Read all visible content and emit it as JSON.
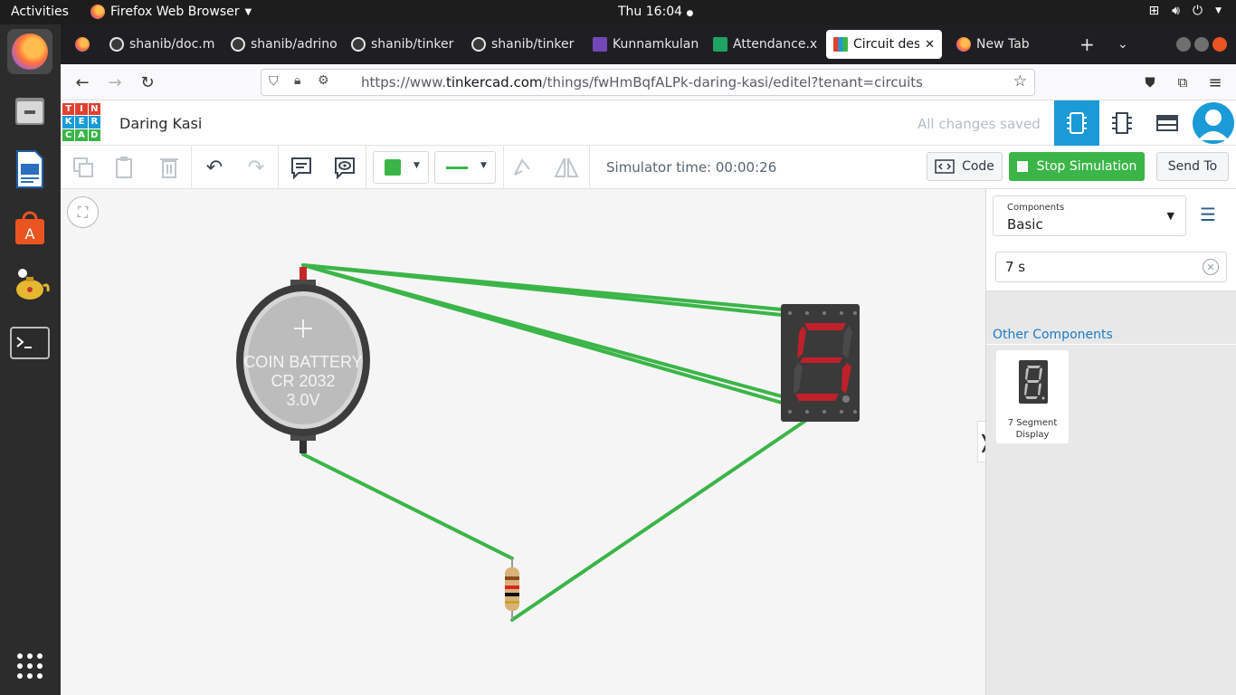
{
  "system": {
    "activities": "Activities",
    "app_name": "Firefox Web Browser",
    "clock": "Thu 16:04"
  },
  "dock": {
    "items": [
      "firefox-icon",
      "files-icon",
      "writer-icon",
      "software-icon",
      "teapot-icon",
      "terminal-icon",
      "apps-grid-icon"
    ]
  },
  "browser": {
    "tabs": [
      {
        "label": "shanib/doc.m",
        "icon": "github-icon"
      },
      {
        "label": "shanib/adrino",
        "icon": "github-icon"
      },
      {
        "label": "shanib/tinker",
        "icon": "github-icon"
      },
      {
        "label": "shanib/tinker",
        "icon": "github-icon"
      },
      {
        "label": "Kunnamkulan",
        "icon": "forms-icon"
      },
      {
        "label": "Attendance.x",
        "icon": "sheets-icon"
      },
      {
        "label": "Circuit desi",
        "icon": "tinkercad-icon",
        "active": true
      },
      {
        "label": "New Tab",
        "icon": "firefox-icon"
      }
    ],
    "url_prefix": "https://www.",
    "url_host": "tinkercad.com",
    "url_path": "/things/fwHmBqfALPk-daring-kasi/editel?tenant=circuits"
  },
  "app": {
    "logo_letters": [
      "T",
      "I",
      "N",
      "K",
      "E",
      "R",
      "C",
      "A",
      "D"
    ],
    "logo_colors": [
      "#e2412f",
      "#e2412f",
      "#e2412f",
      "#1a9ad6",
      "#1a9ad6",
      "#1a9ad6",
      "#3bb548",
      "#3bb548",
      "#3bb548"
    ],
    "design_title": "Daring Kasi",
    "save_status": "All changes saved"
  },
  "toolbar": {
    "wire_color": "#3bb548",
    "simulator_time": "Simulator time: 00:00:26",
    "code_label": "Code",
    "stop_label": "Stop Simulation",
    "send_label": "Send To"
  },
  "circuit": {
    "battery_label_line1": "COIN BATTERY",
    "battery_label_line2": "CR 2032",
    "battery_label_line3": "3.0V",
    "display_digit": "5"
  },
  "panel": {
    "components_label": "Components",
    "components_value": "Basic",
    "search_value": "7 s",
    "other_heading": "Other Components",
    "card_label": "7 Segment Display"
  }
}
